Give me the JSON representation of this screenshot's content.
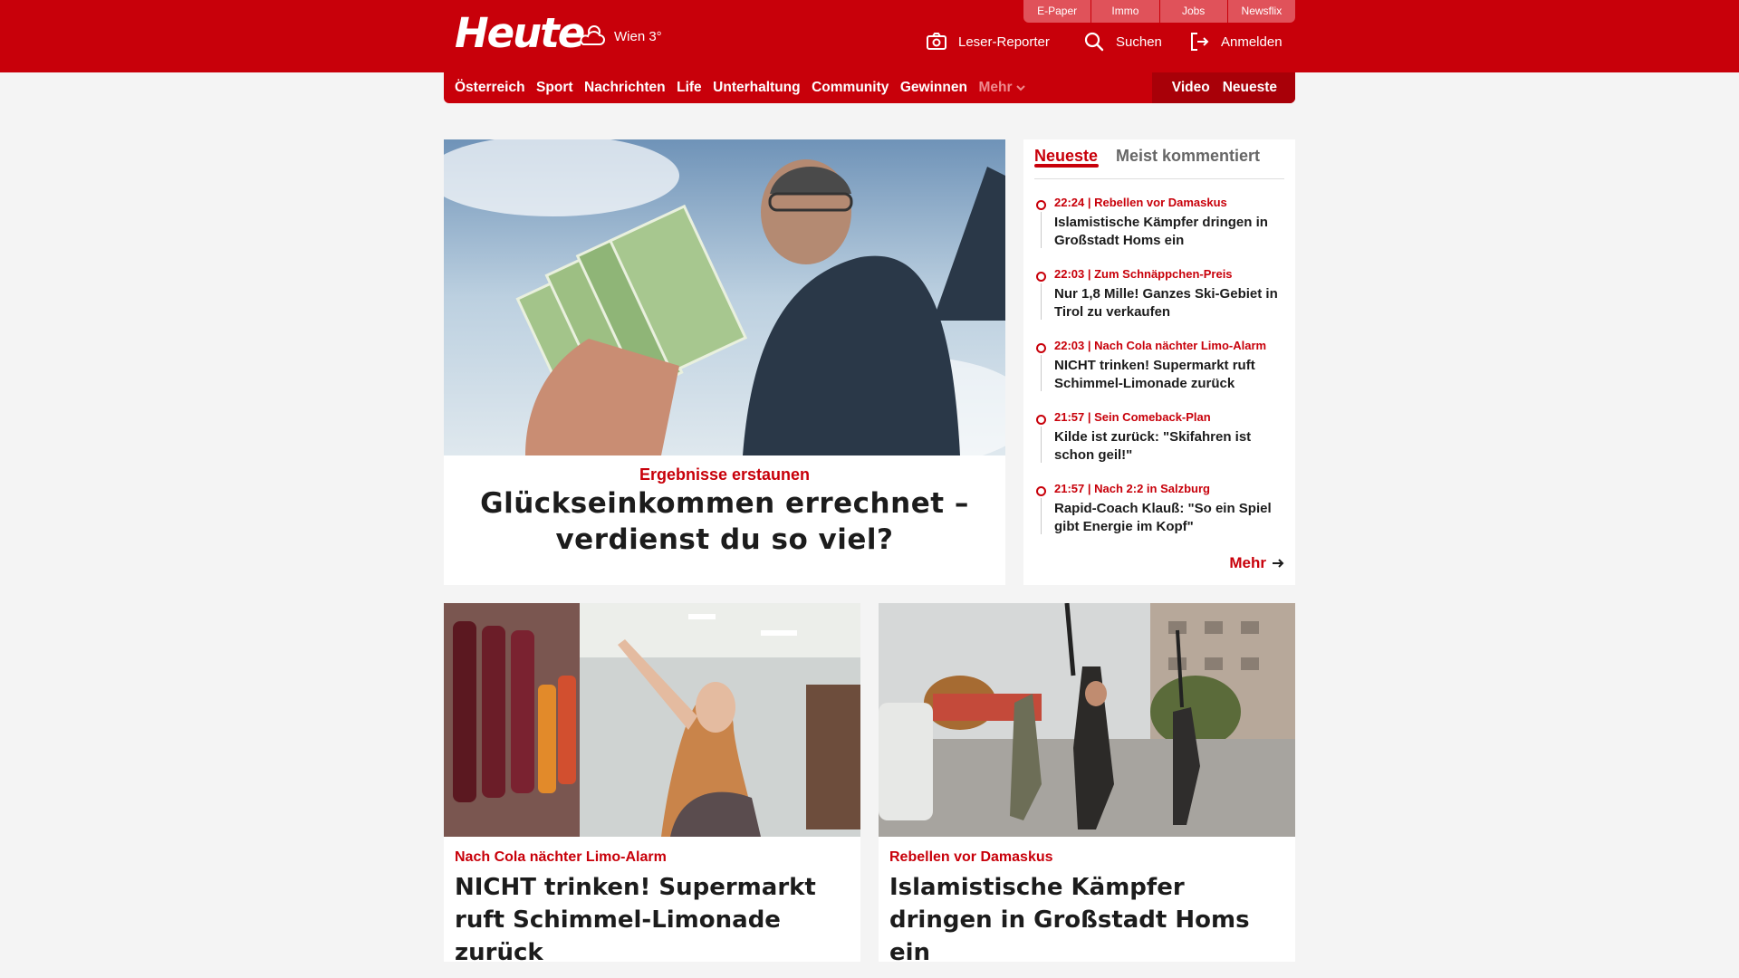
{
  "header": {
    "logo": "Heute",
    "weather": "Wien 3°",
    "top_tabs": [
      "E-Paper",
      "Immo",
      "Jobs",
      "Newsflix"
    ],
    "actions": {
      "reporter": "Leser-Reporter",
      "search": "Suchen",
      "login": "Anmelden"
    }
  },
  "nav": {
    "items": [
      "Österreich",
      "Sport",
      "Nachrichten",
      "Life",
      "Unterhaltung",
      "Community",
      "Gewinnen"
    ],
    "more": "Mehr",
    "right": [
      "Video",
      "Neueste"
    ]
  },
  "hero": {
    "kicker": "Ergebnisse erstaunen",
    "title": "Glückseinkommen errechnet – verdienst du so viel?"
  },
  "sidebar": {
    "tabs": [
      "Neueste",
      "Meist kommentiert"
    ],
    "items": [
      {
        "meta": "22:24 | Rebellen vor Damaskus",
        "title": "Islamistische Kämpfer dringen in Großstadt Homs ein"
      },
      {
        "meta": "22:03 | Zum Schnäppchen-Preis",
        "title": "Nur 1,8 Mille! Ganzes Ski-Gebiet in Tirol zu verkaufen"
      },
      {
        "meta": "22:03 | Nach Cola nächter Limo-Alarm",
        "title": "NICHT trinken! Supermarkt ruft Schimmel-Limonade zurück"
      },
      {
        "meta": "21:57 | Sein Comeback-Plan",
        "title": "Kilde ist zurück: \"Skifahren ist schon geil!\""
      },
      {
        "meta": "21:57 | Nach 2:2 in Salzburg",
        "title": "Rapid-Coach Klauß: \"So ein Spiel gibt Energie im Kopf\""
      }
    ],
    "more": "Mehr"
  },
  "cards": [
    {
      "kicker": "Nach Cola nächter Limo-Alarm",
      "title": "NICHT trinken! Supermarkt ruft Schimmel-Limonade zurück"
    },
    {
      "kicker": "Rebellen vor Damaskus",
      "title": "Islamistische Kämpfer dringen in Großstadt Homs ein"
    }
  ],
  "colors": {
    "brand": "#c8000a",
    "background": "#f4f4f4"
  },
  "icons": [
    "weather-cloud-icon",
    "camera-icon",
    "search-icon",
    "login-icon",
    "chevron-down-icon",
    "arrow-right-icon"
  ]
}
